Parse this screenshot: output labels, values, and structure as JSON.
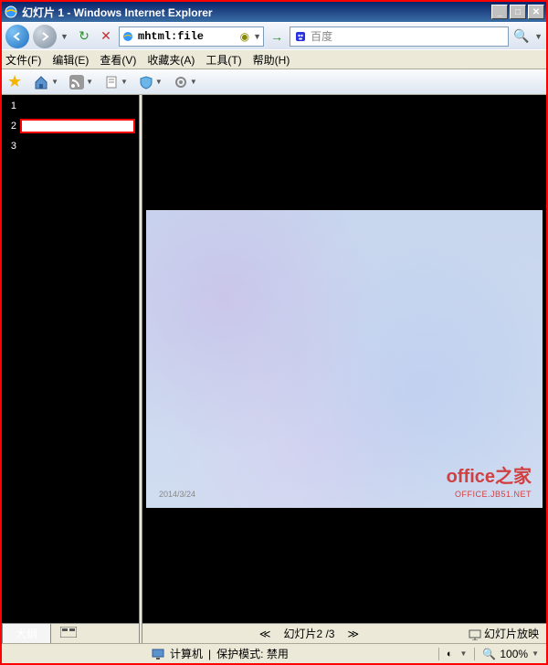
{
  "window": {
    "title": "幻灯片 1 - Windows Internet Explorer"
  },
  "nav": {
    "address": "mhtml:file",
    "search_placeholder": "百度"
  },
  "menus": {
    "file": "文件(F)",
    "edit": "编辑(E)",
    "view": "查看(V)",
    "favorites": "收藏夹(A)",
    "tools": "工具(T)",
    "help": "帮助(H)"
  },
  "thumbs": [
    {
      "n": "1"
    },
    {
      "n": "2"
    },
    {
      "n": "3"
    }
  ],
  "sidebar": {
    "tab_outline": "大纲"
  },
  "slide": {
    "watermark": "office之家",
    "subtext": "OFFICE.JB51.NET",
    "date": "2014/3/24"
  },
  "slidenav": {
    "label": "幻灯片2 /3",
    "slideshow": "幻灯片放映"
  },
  "status": {
    "computer": "计算机",
    "protected": "保护模式: 禁用",
    "zoom": "100%"
  }
}
